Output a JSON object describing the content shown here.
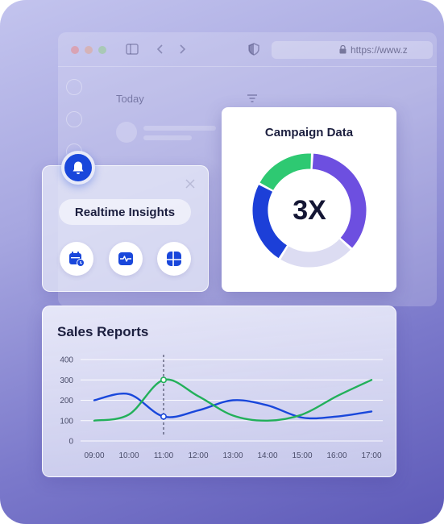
{
  "browser": {
    "url": "https://www.z",
    "today_label": "Today"
  },
  "campaign": {
    "title": "Campaign Data",
    "center_value": "3X",
    "segments": [
      {
        "name": "purple",
        "value": 36,
        "color": "#6d4fe0"
      },
      {
        "name": "light",
        "value": 22,
        "color": "#dcdcf2"
      },
      {
        "name": "blue",
        "value": 24,
        "color": "#1c3fd8"
      },
      {
        "name": "green",
        "value": 18,
        "color": "#2ec972"
      }
    ]
  },
  "insights": {
    "title": "Realtime Insights",
    "buttons": [
      "calendar-clock-icon",
      "activity-icon",
      "grid-layout-icon"
    ]
  },
  "colors": {
    "accent_blue": "#1947db",
    "green": "#22b05a"
  },
  "chart_data": {
    "type": "line",
    "title": "Sales Reports",
    "categories": [
      "09:00",
      "10:00",
      "11:00",
      "12:00",
      "13:00",
      "14:00",
      "15:00",
      "16:00",
      "17:00"
    ],
    "yticks": [
      "0",
      "100",
      "200",
      "300",
      "400"
    ],
    "ylim": [
      0,
      400
    ],
    "series": [
      {
        "color": "#1947db",
        "values": [
          200,
          230,
          120,
          150,
          200,
          175,
          115,
          120,
          145
        ]
      },
      {
        "color": "#22b05a",
        "values": [
          100,
          130,
          300,
          220,
          125,
          100,
          130,
          220,
          300
        ]
      }
    ],
    "highlight": "11:00",
    "grid": true
  }
}
